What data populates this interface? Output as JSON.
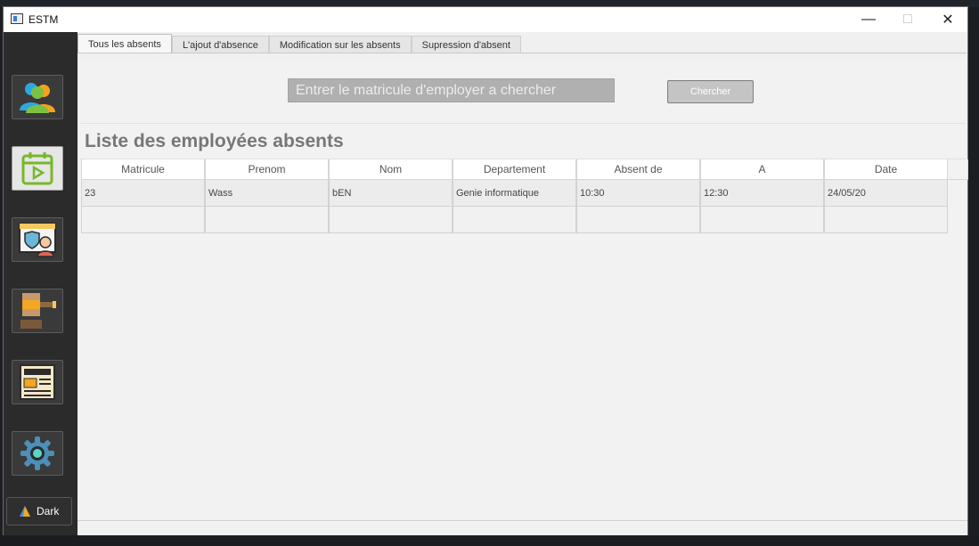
{
  "window": {
    "title": "ESTM"
  },
  "tabs": [
    {
      "label": "Tous les absents",
      "active": true
    },
    {
      "label": "L'ajout d'absence",
      "active": false
    },
    {
      "label": "Modification sur les absents",
      "active": false
    },
    {
      "label": "Supression d'absent",
      "active": false
    }
  ],
  "sidebar": {
    "items": [
      {
        "icon": "users-icon"
      },
      {
        "icon": "calendar-play-icon",
        "active": true
      },
      {
        "icon": "security-officer-icon"
      },
      {
        "icon": "gavel-icon"
      },
      {
        "icon": "newspaper-icon"
      },
      {
        "icon": "gear-icon"
      }
    ],
    "theme_button": {
      "label": "Dark",
      "icon": "theme-toggle-icon"
    }
  },
  "search": {
    "placeholder": "Entrer le matricule d'employer a chercher",
    "button_label": "Chercher"
  },
  "list_title": "Liste des employées absents",
  "table": {
    "columns": [
      "Matricule",
      "Prenom",
      "Nom",
      "Departement",
      "Absent de",
      "A",
      "Date"
    ],
    "rows": [
      [
        "23",
        "Wass",
        "bEN",
        "Genie informatique",
        "10:30",
        "12:30",
        "24/05/20"
      ]
    ]
  },
  "colors": {
    "sidebar_bg": "#2b2b2b",
    "search_input_bg": "#b0b0b0",
    "title_color": "#777777"
  }
}
